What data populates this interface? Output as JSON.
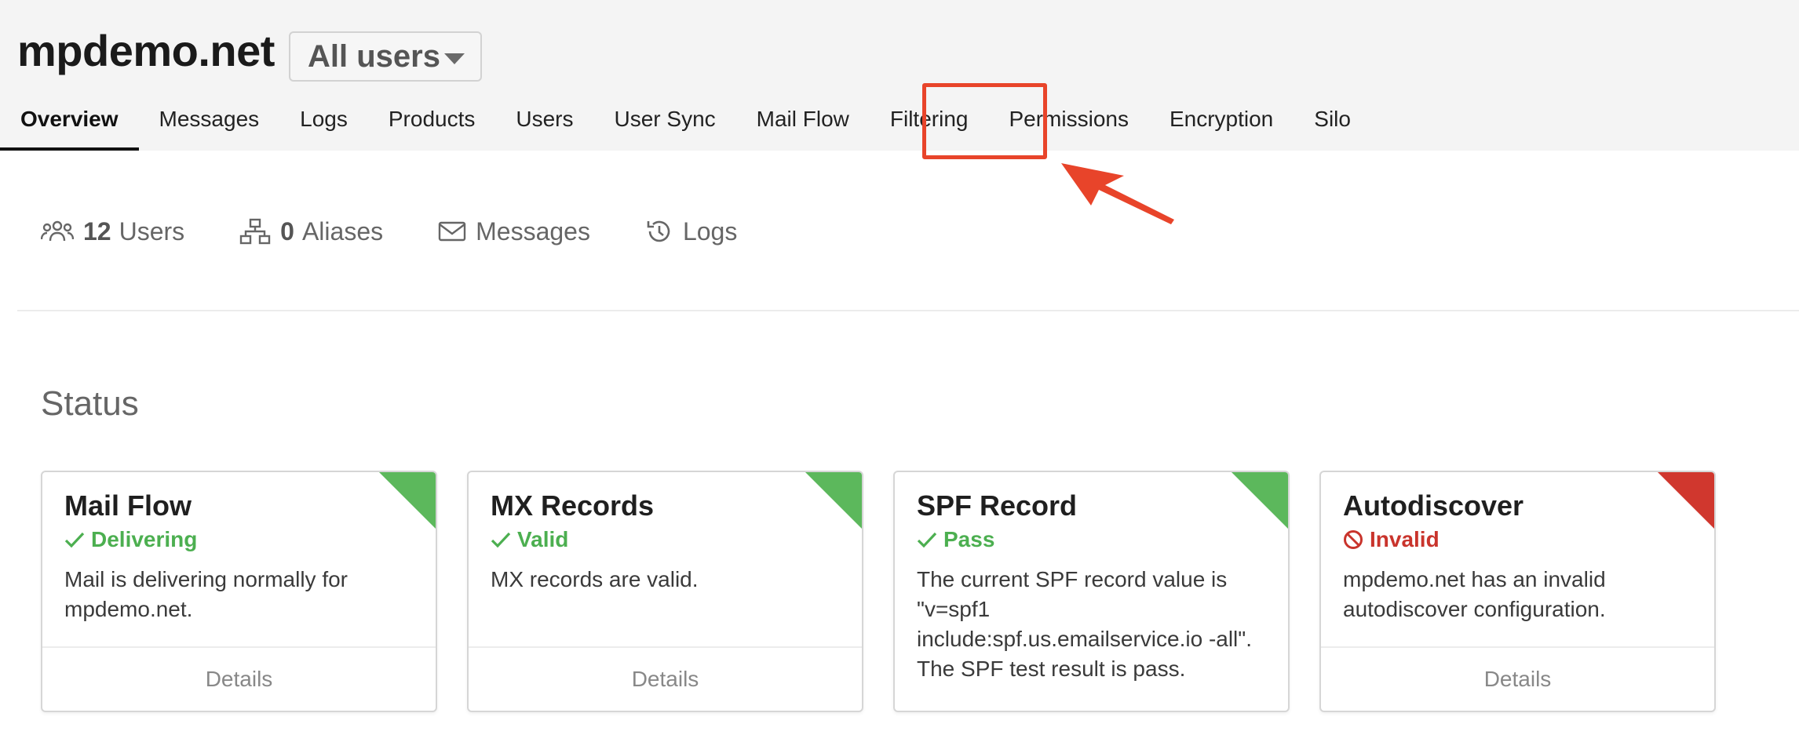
{
  "header": {
    "domain": "mpdemo.net",
    "user_filter": "All users"
  },
  "tabs": [
    {
      "label": "Overview",
      "active": true
    },
    {
      "label": "Messages"
    },
    {
      "label": "Logs"
    },
    {
      "label": "Products"
    },
    {
      "label": "Users"
    },
    {
      "label": "User Sync"
    },
    {
      "label": "Mail Flow"
    },
    {
      "label": "Filtering",
      "highlighted": true
    },
    {
      "label": "Permissions"
    },
    {
      "label": "Encryption"
    },
    {
      "label": "Silo"
    }
  ],
  "stats": {
    "users": {
      "count": "12",
      "label": "Users",
      "icon": "users-icon"
    },
    "aliases": {
      "count": "0",
      "label": "Aliases",
      "icon": "sitemap-icon"
    },
    "messages": {
      "label": "Messages",
      "icon": "envelope-icon"
    },
    "logs": {
      "label": "Logs",
      "icon": "history-icon"
    }
  },
  "status": {
    "heading": "Status",
    "cards": [
      {
        "title": "Mail Flow",
        "state": "Delivering",
        "state_type": "ok",
        "description": "Mail is delivering normally for mpdemo.net.",
        "footer": "Details"
      },
      {
        "title": "MX Records",
        "state": "Valid",
        "state_type": "ok",
        "description": "MX records are valid.",
        "footer": "Details"
      },
      {
        "title": "SPF Record",
        "state": "Pass",
        "state_type": "ok",
        "description": "The current SPF record value is \"v=spf1 include:spf.us.emailservice.io -all\". The SPF test result is pass."
      },
      {
        "title": "Autodiscover",
        "state": "Invalid",
        "state_type": "bad",
        "description": "mpdemo.net has an invalid autodiscover configuration.",
        "footer": "Details"
      }
    ]
  },
  "colors": {
    "ok": "#5cb85c",
    "bad": "#d0372e",
    "annotation": "#e8442a"
  }
}
